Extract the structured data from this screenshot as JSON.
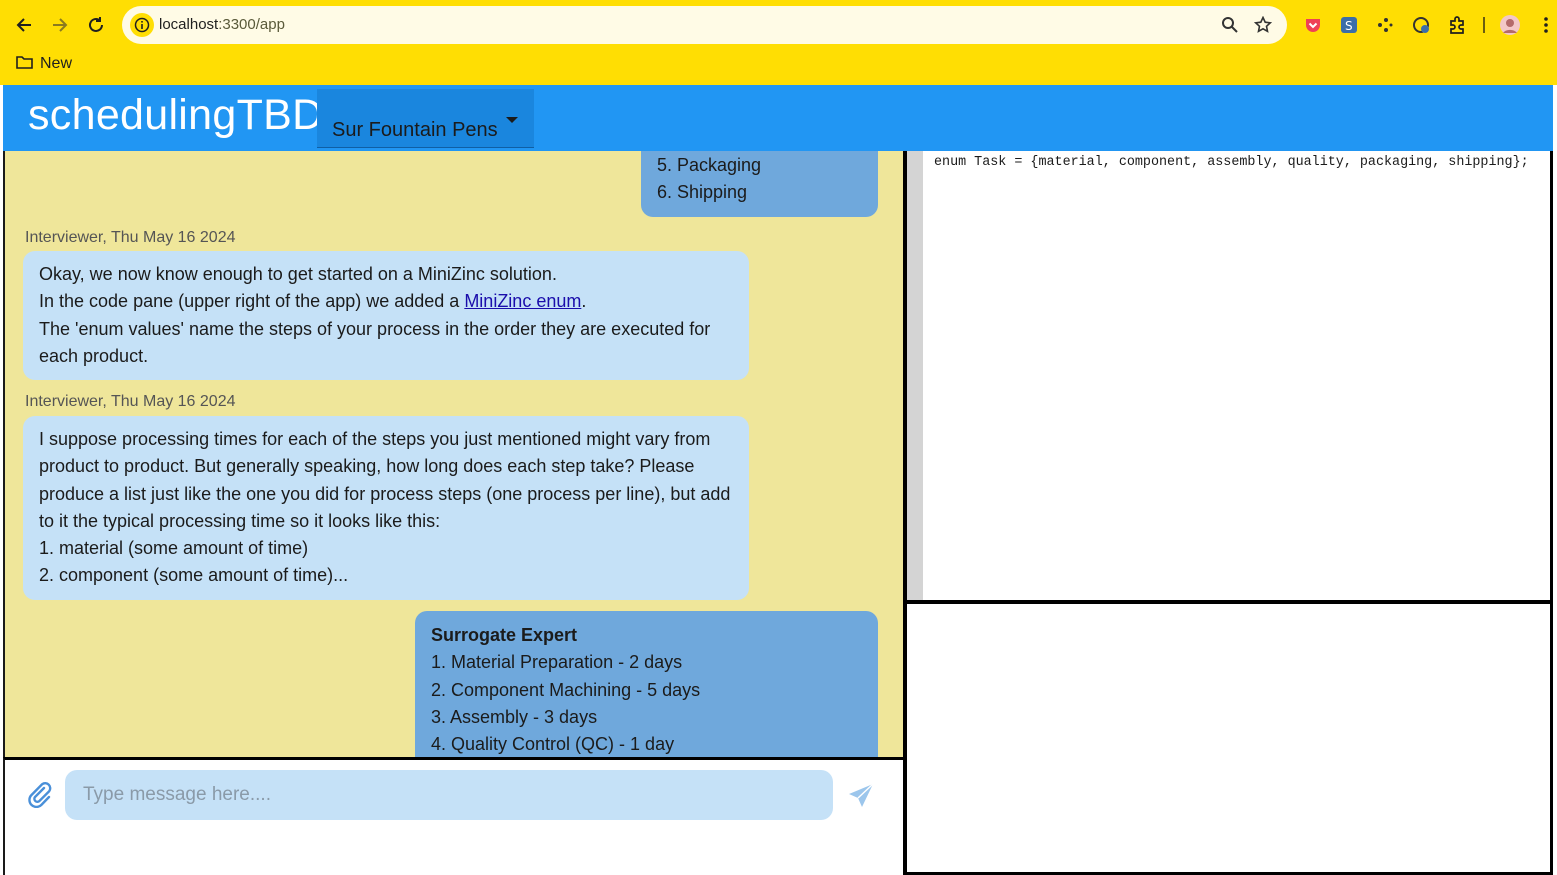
{
  "browser": {
    "url_host": "localhost",
    "url_path": ":3300/app",
    "bookmark_label": "New",
    "colors": {
      "chrome": "#ffde03",
      "url_bg": "#fffbe6"
    }
  },
  "app": {
    "title": "schedulingTBD",
    "project_selected": "Sur Fountain Pens",
    "colors": {
      "header": "#2196f3",
      "chat_bg": "#efe69a",
      "surrogate_bubble": "#6fa8dc",
      "interviewer_bubble": "#c5e1f7"
    }
  },
  "chat": {
    "messages": [
      {
        "from": "surrogate",
        "lines": [
          "5. Packaging",
          "6. Shipping"
        ]
      },
      {
        "from": "interviewer",
        "header": "Interviewer, Thu May 16 2024",
        "line1": "Okay, we now know enough to get started on a MiniZinc solution.",
        "line2_prefix": "In the code pane (upper right of the app) we added a ",
        "line2_link": "MiniZinc enum",
        "line2_suffix": ".",
        "line3": "The 'enum values' name the steps of your process in the order they are executed for each product."
      },
      {
        "from": "interviewer",
        "header": "Interviewer, Thu May 16 2024",
        "body": "I suppose processing times for each of the steps you just mentioned might vary from product to product. But generally speaking, how long does each step take? Please produce a list just like the one you did for process steps (one process per line), but add to it the typical processing time so it looks like this:",
        "list": [
          "1. material (some amount of time)",
          "2. component (some amount of time)..."
        ]
      },
      {
        "from": "surrogate",
        "title": "Surrogate Expert",
        "lines": [
          "1. Material Preparation - 2 days",
          "2. Component Machining - 5 days",
          "3. Assembly - 3 days",
          "4. Quality Control (QC) - 1 day"
        ]
      }
    ],
    "input_placeholder": "Type message here...."
  },
  "code_pane": {
    "code": "enum Task = {material, component, assembly, quality, packaging, shipping};"
  }
}
